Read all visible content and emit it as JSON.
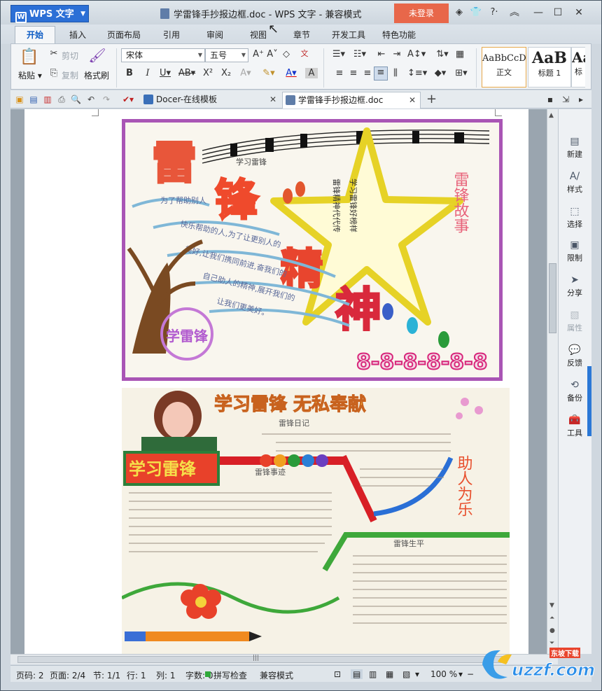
{
  "app": {
    "name": "WPS 文字",
    "window_title": "学雷锋手抄报边框.doc - WPS 文字 - 兼容模式",
    "login": "未登录"
  },
  "tabs": [
    "开始",
    "插入",
    "页面布局",
    "引用",
    "审阅",
    "视图",
    "章节",
    "开发工具",
    "特色功能"
  ],
  "ribbon": {
    "paste": "粘贴",
    "cut": "剪切",
    "copy": "复制",
    "format_painter": "格式刷",
    "font": "宋体",
    "size": "五号",
    "styles": [
      {
        "sample": "AaBbCcD",
        "name": "正文"
      },
      {
        "sample": "AaB",
        "name": "标题 1"
      },
      {
        "sample": "Aa",
        "name": "标"
      }
    ]
  },
  "doc_tabs": [
    {
      "label": "Docer-在线模板",
      "color": "#3a6fb8"
    },
    {
      "label": "学雷锋手抄报边框.doc",
      "color": "#5f7da8"
    }
  ],
  "poster1": {
    "title_chars": [
      "雷",
      "锋",
      "精",
      "神"
    ],
    "song": "学习雷锋",
    "left_heading": "为了帮助别人",
    "lines": [
      "快乐帮助的人,为了让更别人的",
      "美好,让我们携同前进,奋我们的",
      "自己助人的精神,展开我们的",
      "让我们更美好。"
    ],
    "badge": "学雷锋",
    "star_text": [
      "雷锋精神代代传",
      "学习雷锋好榜样"
    ],
    "right_title": "雷锋故事",
    "bottom_pattern": "8-8-8-8-8-8"
  },
  "poster2": {
    "title": "学习雷锋 无私奉献",
    "badge": "学习雷锋",
    "section1": "雷锋日记",
    "section2": "雷锋事迹",
    "section3": "雷锋生平",
    "right_title": "助人为乐"
  },
  "right_panel": [
    {
      "label": "新建",
      "icon": "new-icon",
      "dim": false
    },
    {
      "label": "样式",
      "icon": "style-icon",
      "dim": false
    },
    {
      "label": "选择",
      "icon": "select-icon",
      "dim": false
    },
    {
      "label": "限制",
      "icon": "restrict-icon",
      "dim": false
    },
    {
      "label": "分享",
      "icon": "share-icon",
      "dim": false
    },
    {
      "label": "属性",
      "icon": "property-icon",
      "dim": true
    },
    {
      "label": "反馈",
      "icon": "feedback-icon",
      "dim": false
    },
    {
      "label": "备份",
      "icon": "backup-icon",
      "dim": false
    },
    {
      "label": "工具",
      "icon": "tool-icon",
      "dim": false
    }
  ],
  "status": {
    "page": "页码: 2",
    "pages": "页面: 2/4",
    "section": "节: 1/1",
    "row": "行: 1",
    "col": "列: 1",
    "words": "字数: 0",
    "spell": "拼写检查",
    "mode": "兼容模式",
    "zoom": "100 %"
  },
  "watermark": {
    "brand": "uzzf.com",
    "cn": "东坡下载"
  }
}
